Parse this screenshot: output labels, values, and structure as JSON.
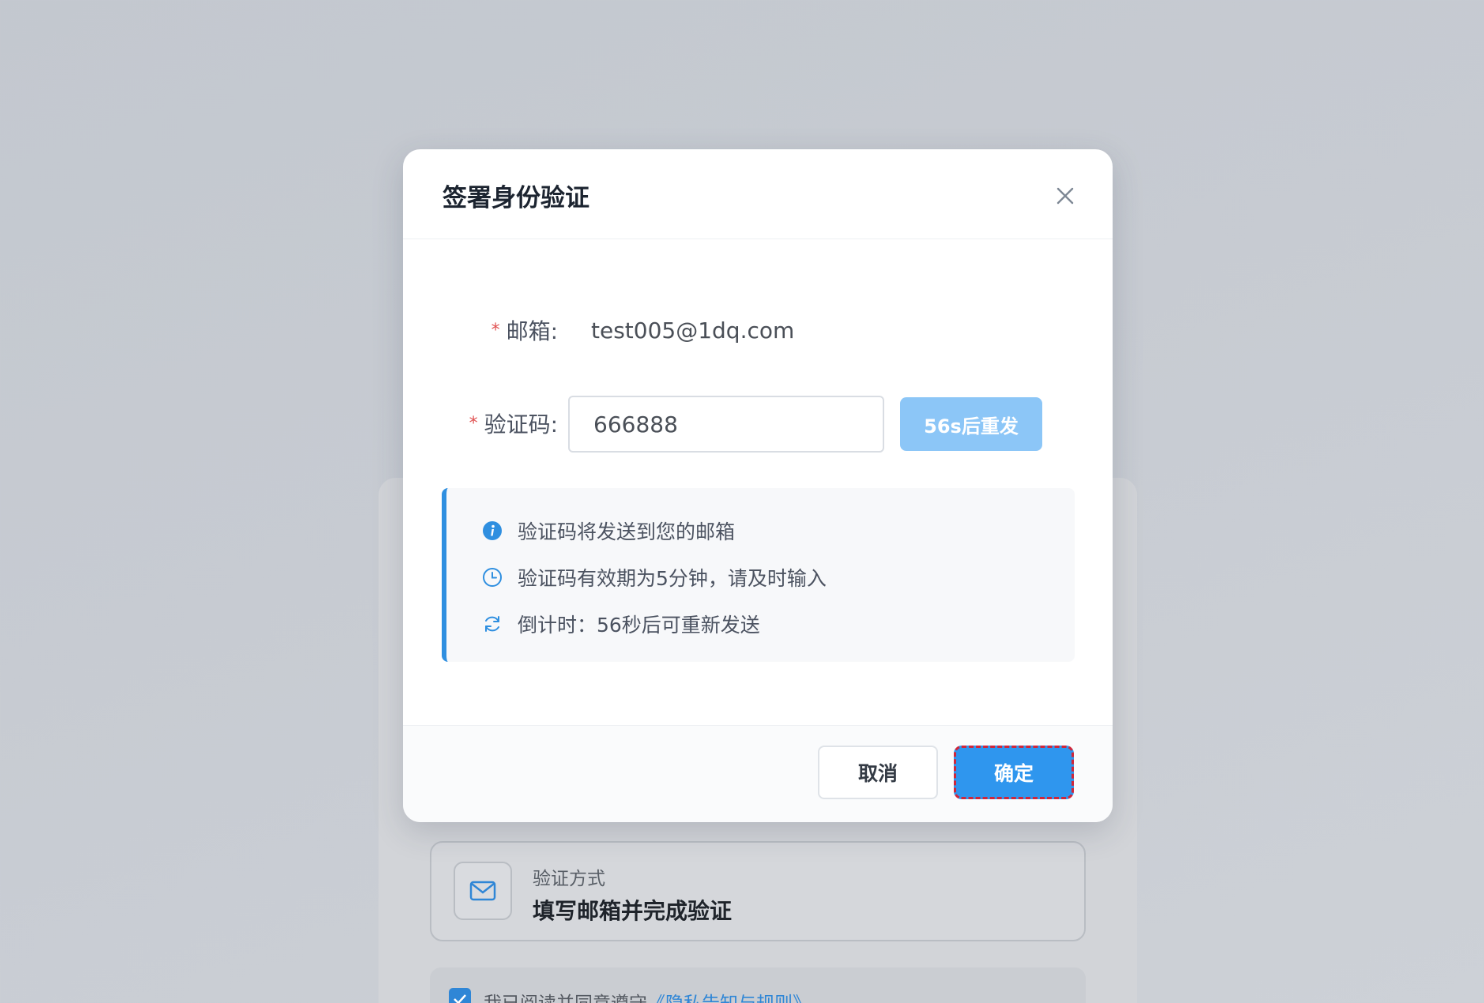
{
  "modal": {
    "title": "签署身份验证",
    "email_label": "邮箱:",
    "email_value": "test005@1dq.com",
    "code_label": "验证码:",
    "code_value": "666888",
    "resend_label": "56s后重发",
    "info_lines": [
      {
        "icon": "info-icon",
        "text": "验证码将发送到您的邮箱"
      },
      {
        "icon": "clock-icon",
        "text": "验证码有效期为5分钟，请及时输入"
      },
      {
        "icon": "refresh-icon",
        "text": "倒计时：56秒后可重新发送"
      }
    ],
    "cancel_label": "取消",
    "confirm_label": "确定"
  },
  "background": {
    "method_label": "验证方式",
    "method_value": "填写邮箱并完成验证",
    "agree_text": "我已阅读并同意遵守",
    "agree_link": "《隐私告知与规则》"
  },
  "colors": {
    "accent": "#2f96ee",
    "resend_disabled": "#8cc6f7",
    "required_star": "#e05252",
    "highlight_border": "#d0263a"
  }
}
